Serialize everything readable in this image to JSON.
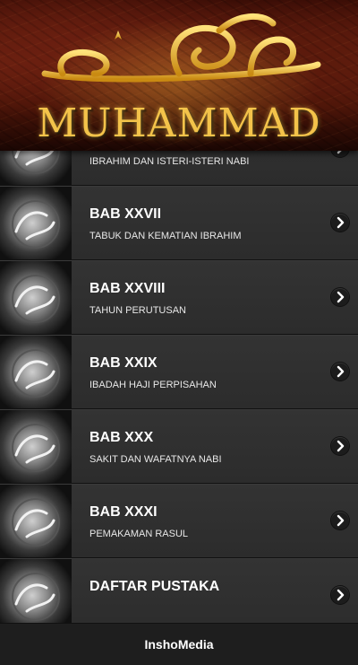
{
  "header": {
    "title": "MUHAMMAD",
    "calligraphy_icon": "calligraphy-muhammad-icon",
    "accent": "#f3c34a"
  },
  "list": {
    "items": [
      {
        "title": "",
        "subtitle": "IBRAHIM DAN ISTERI-ISTERI NABI",
        "thumb_icon": "calligraphy-medallion-icon"
      },
      {
        "title": "BAB XXVII",
        "subtitle": "TABUK DAN KEMATIAN IBRAHIM",
        "thumb_icon": "calligraphy-medallion-icon"
      },
      {
        "title": "BAB XXVIII",
        "subtitle": "TAHUN PERUTUSAN",
        "thumb_icon": "calligraphy-medallion-icon"
      },
      {
        "title": "BAB XXIX",
        "subtitle": "IBADAH HAJI PERPISAHAN",
        "thumb_icon": "calligraphy-medallion-icon"
      },
      {
        "title": "BAB XXX",
        "subtitle": "SAKIT DAN WAFATNYA NABI",
        "thumb_icon": "calligraphy-medallion-icon"
      },
      {
        "title": "BAB XXXI",
        "subtitle": "PEMAKAMAN RASUL",
        "thumb_icon": "calligraphy-medallion-icon"
      },
      {
        "title": "DAFTAR PUSTAKA",
        "subtitle": "",
        "thumb_icon": "calligraphy-medallion-icon"
      }
    ],
    "chevron_icon": "chevron-right-icon"
  },
  "footer": {
    "label": "InshoMedia"
  }
}
